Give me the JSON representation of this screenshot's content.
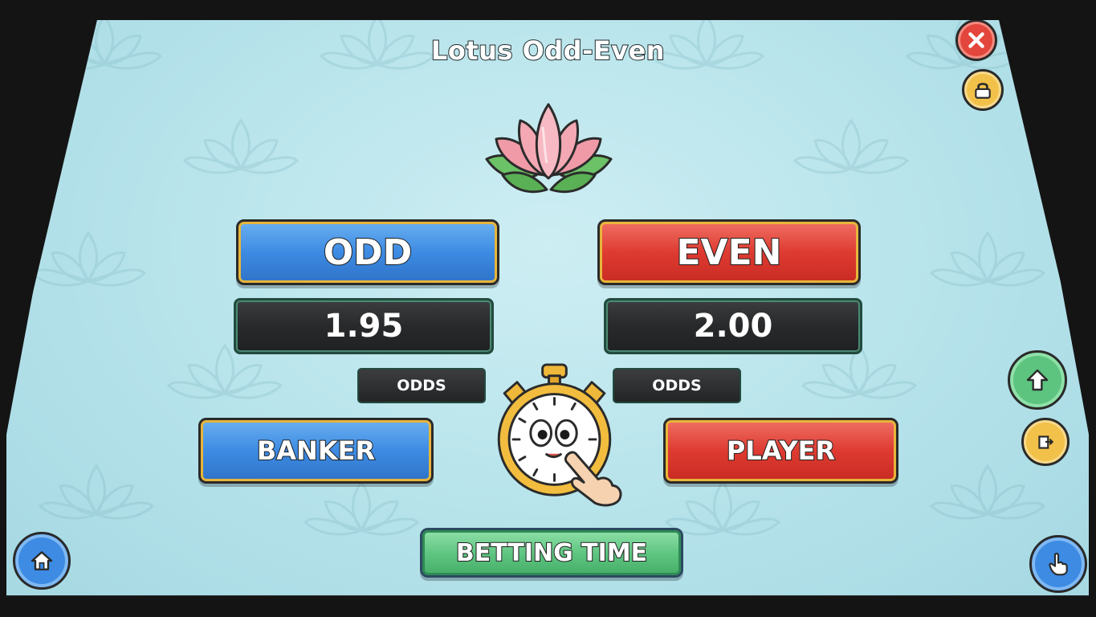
{
  "game": {
    "title": "Lotus Odd-Even"
  },
  "bets": {
    "odd_label": "ODD",
    "even_label": "EVEN",
    "odd_value": "1.95",
    "even_value": "2.00",
    "odds_caption_left": "ODDS",
    "odds_caption_right": "ODDS",
    "banker_label": "BANKER",
    "player_label": "PLAYER"
  },
  "status": {
    "betting_label": "BETTING TIME"
  },
  "icons": {
    "close": "close-icon",
    "lock": "lock-icon",
    "up_arrow": "arrow-up-icon",
    "share": "share-icon",
    "home": "home-icon",
    "hand": "hand-pointer-icon",
    "timer": "stopwatch-icon",
    "logo": "lotus-icon"
  },
  "colors": {
    "blue": "#3d8be3",
    "red": "#de3b31",
    "green": "#5cc47f",
    "gold": "#e7b53a",
    "background": "#b5e2ea"
  }
}
